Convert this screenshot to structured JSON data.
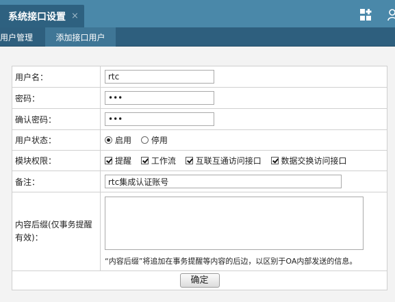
{
  "titlebar": {
    "tab_title": "系统接口设置",
    "close_glyph": "×",
    "icons": [
      "apps-add-icon",
      "user-icon"
    ]
  },
  "subnav": {
    "items": [
      {
        "label": "用户管理",
        "active": false
      },
      {
        "label": "添加接口用户",
        "active": true
      }
    ]
  },
  "form": {
    "username": {
      "label": "用户名：",
      "value": "rtc"
    },
    "password": {
      "label": "密码：",
      "value": "•••"
    },
    "confirm_password": {
      "label": "确认密码：",
      "value": "•••"
    },
    "status": {
      "label": "用户状态：",
      "options": [
        {
          "label": "启用",
          "checked": true
        },
        {
          "label": "停用",
          "checked": false
        }
      ]
    },
    "permissions": {
      "label": "模块权限：",
      "options": [
        {
          "label": "提醒",
          "checked": true
        },
        {
          "label": "工作流",
          "checked": true
        },
        {
          "label": "互联互通访问接口",
          "checked": true
        },
        {
          "label": "数据交换访问接口",
          "checked": true
        }
      ]
    },
    "remark": {
      "label": "备注：",
      "value": "rtc集成认证账号"
    },
    "suffix": {
      "label": "内容后缀(仅事务提醒有效)：",
      "value": "",
      "hint": "“内容后缀”将追加在事务提醒等内容的后边，以区别于OA内部发送的信息。"
    },
    "submit_label": "确定"
  },
  "colors": {
    "titlebar_bg": "#4a88a9",
    "active_tab_bg": "#2e6180",
    "subnav_bg": "#2e5f7e",
    "page_bg": "#f3f3f3"
  }
}
